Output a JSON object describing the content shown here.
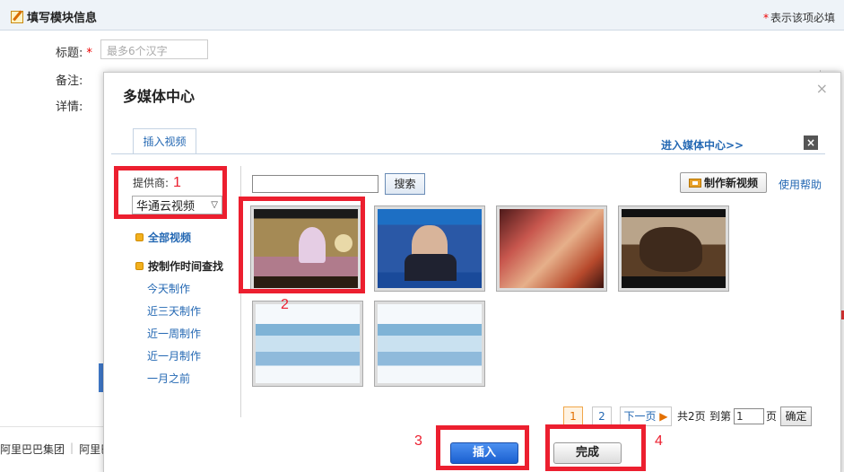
{
  "form": {
    "header_title": "填写模块信息",
    "required_note": "表示该项必填",
    "required_star": "*",
    "title_label": "标题:",
    "title_placeholder": "最多6个汉字",
    "remark_label": "备注:",
    "detail_label": "详情:",
    "footer": [
      "阿里巴巴集团",
      "阿里巴"
    ]
  },
  "dialog": {
    "title": "多媒体中心",
    "close": "×",
    "tab": "插入视频",
    "enter_link": "进入媒体中心>>",
    "provider_label": "提供商:",
    "provider_value": "华通云视频",
    "nav": {
      "all": "全部视频",
      "by_time": "按制作时间查找",
      "sub_items": [
        "今天制作",
        "近三天制作",
        "近一周制作",
        "近一月制作",
        "一月之前"
      ]
    },
    "search_button": "搜索",
    "make_button": "制作新视频",
    "help_link": "使用帮助",
    "pager": {
      "pages": [
        "1",
        "2"
      ],
      "current": "1",
      "next": "下一页",
      "total": "共2页",
      "goto_prefix": "到第",
      "goto_value": "1",
      "goto_suffix": "页",
      "ok": "确定"
    },
    "insert_button": "插入",
    "done_button": "完成"
  },
  "annotations": {
    "labels": [
      "1",
      "2",
      "3",
      "4"
    ],
    "color": "#ec1f2f"
  }
}
